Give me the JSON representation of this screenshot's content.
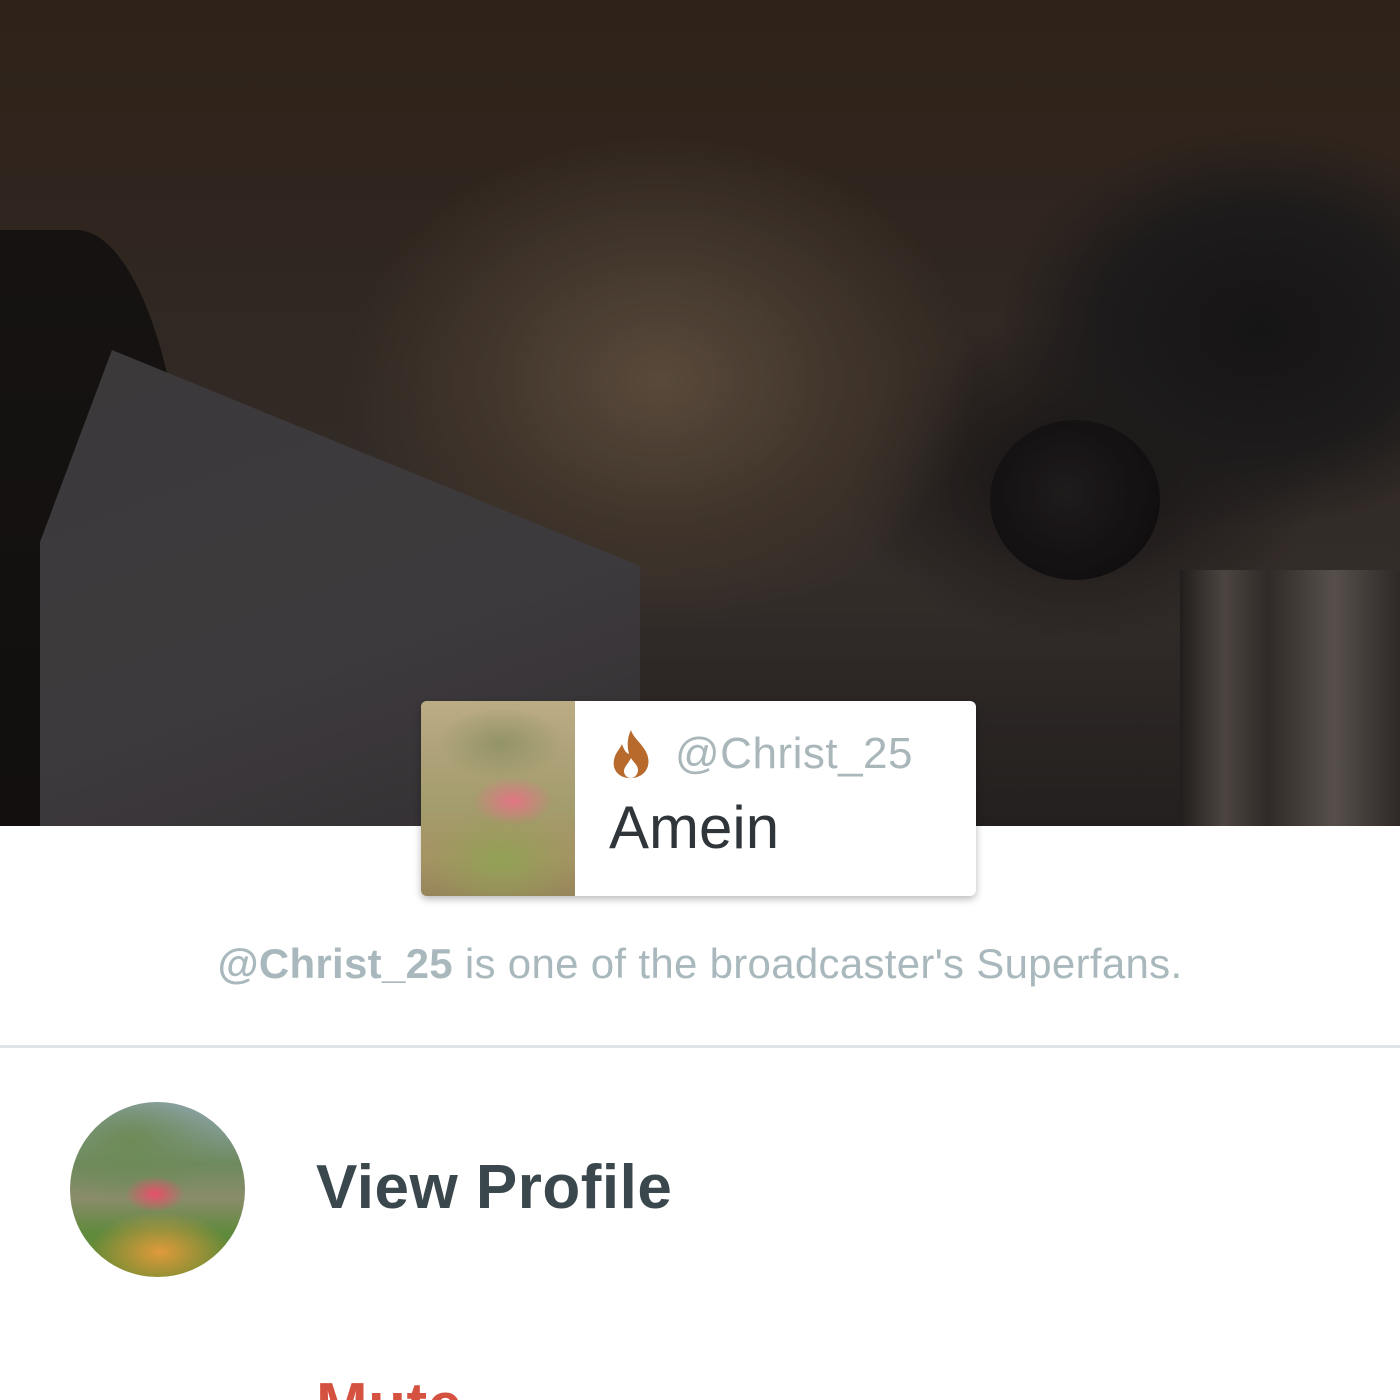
{
  "comment": {
    "username": "@Christ_25",
    "text": "Amein",
    "badge_icon": "flame-icon",
    "badge_color": "#b86a2c"
  },
  "superfan_note": {
    "handle": "@Christ_25",
    "text": " is one of the broadcaster's Superfans."
  },
  "actions": {
    "view_profile_label": "View Profile",
    "mute_label": "Mute",
    "mute_color": "#d4523f"
  }
}
